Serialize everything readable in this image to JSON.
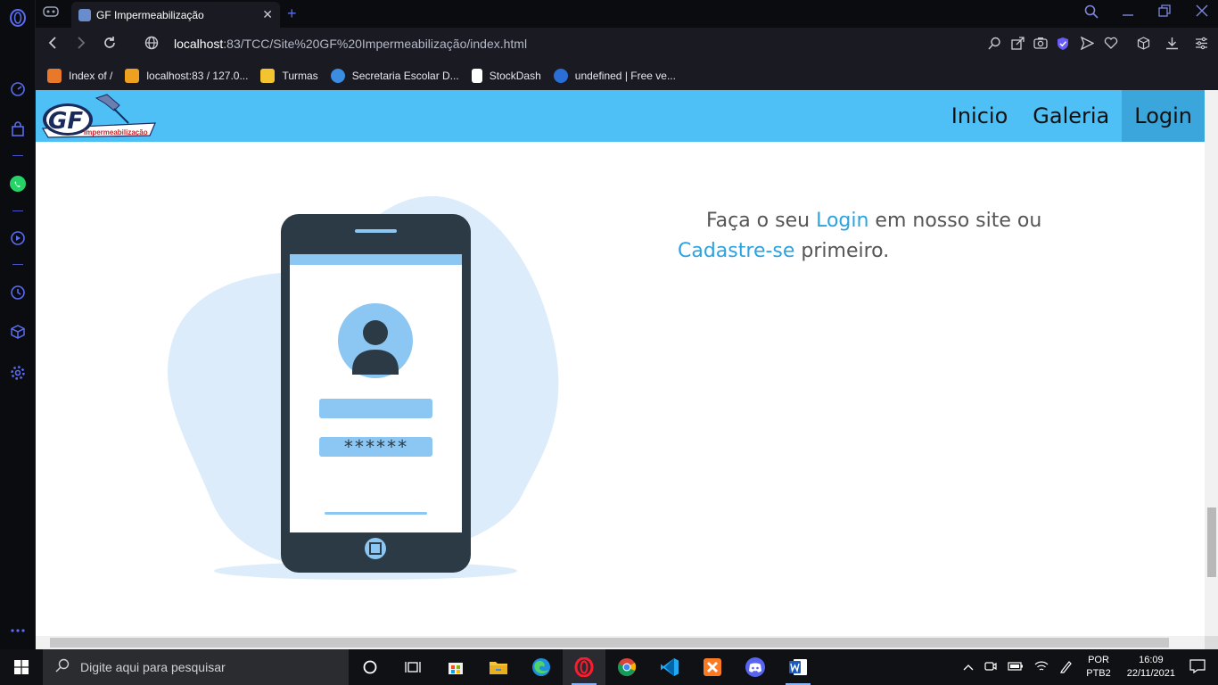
{
  "browser": {
    "tab_title": "GF Impermeabilização",
    "url_host": "localhost",
    "url_path": ":83/TCC/Site%20GF%20Impermeabilização/index.html",
    "bookmarks": [
      {
        "label": "Index of /",
        "color": "#e8792b"
      },
      {
        "label": "localhost:83 / 127.0...",
        "color": "#f0a020"
      },
      {
        "label": "Turmas",
        "color": "#f4c430"
      },
      {
        "label": "Secretaria Escolar D...",
        "color": "#3a8de0"
      },
      {
        "label": "StockDash",
        "color": "#ffffff"
      },
      {
        "label": "undefined | Free ve...",
        "color": "#2a6fd6"
      }
    ]
  },
  "site": {
    "logo_text": "GF",
    "logo_subtitle": "Impermeabilização",
    "nav": {
      "inicio": "Inicio",
      "galeria": "Galeria",
      "login": "Login"
    },
    "message": {
      "part1": "Faça o seu ",
      "login_link": "Login",
      "part2": " em nosso site ou",
      "signup_link": "Cadastre-se",
      "part3": " primeiro."
    },
    "illustration": {
      "password_mask": "******"
    },
    "colors": {
      "nav_bg": "#4fc0f5",
      "nav_active": "#3aa6dc",
      "link": "#2aa3e0"
    }
  },
  "taskbar": {
    "search_placeholder": "Digite aqui para pesquisar",
    "lang_top": "POR",
    "lang_bottom": "PTB2",
    "time": "16:09",
    "date": "22/11/2021"
  }
}
